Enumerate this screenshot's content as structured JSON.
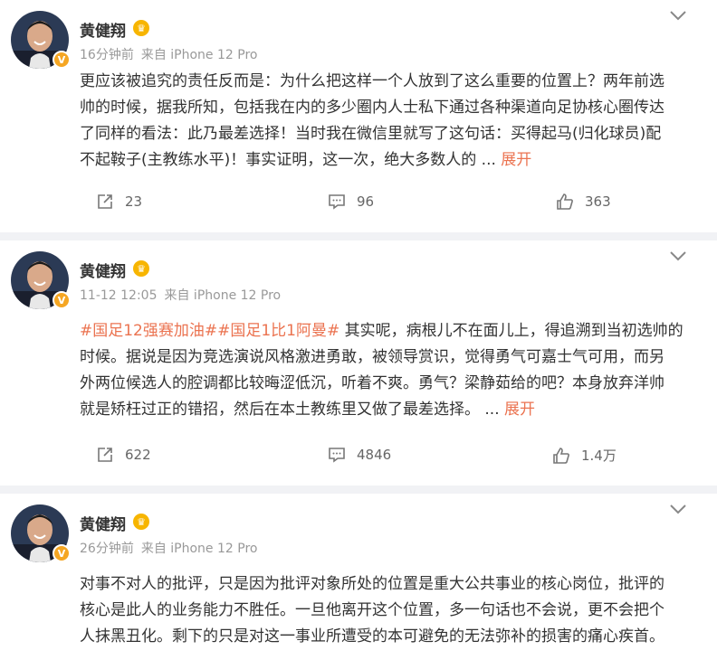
{
  "posts": [
    {
      "author": "黄健翔",
      "time": "16分钟前",
      "source": "来自 iPhone 12 Pro",
      "lines": [
        "更应该被追究的责任反而是：为什么把这样一个人放到了这么重要的位置上？两年前选",
        "帅的时候，据我所知，包括我在内的多少圈内人士私下通过各种渠道向足协核心圈传达",
        "了同样的看法：此乃最差选择！当时我在微信里就写了这句话：买得起马(归化球员)配",
        "不起鞍子(主教练水平)！事实证明，这一次，绝大多数人的  ... "
      ],
      "expand": "展开",
      "reposts": "23",
      "comments": "96",
      "likes": "363"
    },
    {
      "author": "黄健翔",
      "time": "11-12 12:05",
      "source": "来自 iPhone 12 Pro",
      "hashtags": "#国足12强赛加油##国足1比1阿曼#",
      "lines": [
        " 其实呢，病根儿不在面儿上，得追溯到当初选帅的",
        "时候。据说是因为竞选演说风格激进勇敢，被领导赏识，觉得勇气可嘉士气可用，而另",
        "外两位候选人的腔调都比较晦涩低沉，听着不爽。勇气？梁静茹给的吧？本身放弃洋帅",
        "就是矫枉过正的错招，然后在本土教练里又做了最差选择。  ... "
      ],
      "expand": "展开",
      "reposts": "622",
      "comments": "4846",
      "likes": "1.4万"
    },
    {
      "author": "黄健翔",
      "time": "26分钟前",
      "source": "来自 iPhone 12 Pro",
      "lines": [
        "对事不对人的批评，只是因为批评对象所处的位置是重大公共事业的核心岗位，批评的",
        "核心是此人的业务能力不胜任。一旦他离开这个位置，多一句话也不会说，更不会把个",
        "人抹黑丑化。剩下的只是对这一事业所遭受的本可避免的无法弥补的损害的痛心疾首。"
      ]
    }
  ],
  "icons": {
    "verified": "v-badge-icon",
    "vip": "crown-icon",
    "menu": "chevron-down-icon",
    "share": "share-icon",
    "comment": "comment-icon",
    "like": "thumbs-up-icon"
  },
  "colors": {
    "accent": "#eb7350",
    "meta": "#999999",
    "badge": "#f5a623",
    "background": "#f1f2f5"
  }
}
